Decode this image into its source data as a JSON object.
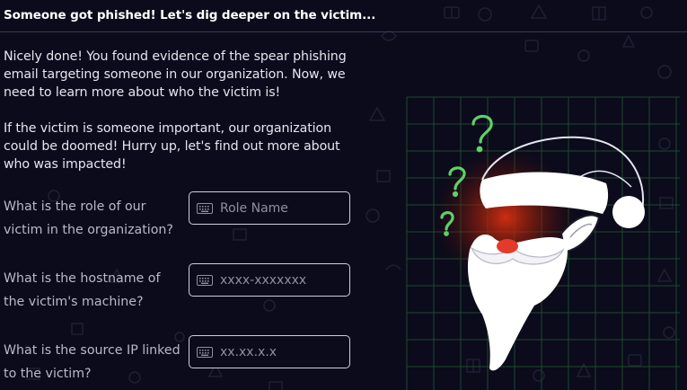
{
  "header": {
    "title": "Someone got phished! Let's dig deeper on the victim..."
  },
  "intro": {
    "paragraph1": "Nicely done! You found evidence of the spear phishing email targeting someone in our organization. Now, we need to learn more about who the victim is!",
    "paragraph2": "If the victim is someone important, our organization could be doomed! Hurry up, let's find out more about who was impacted!"
  },
  "questions": [
    {
      "label": "What is the role of our victim in the organization?",
      "placeholder": "Role Name",
      "value": ""
    },
    {
      "label": "What is the hostname of the victim's machine?",
      "placeholder": "xxxx-xxxxxxx",
      "value": ""
    },
    {
      "label": "What is the source IP linked to the victim?",
      "placeholder": "xx.xx.x.x",
      "value": ""
    }
  ],
  "icons": {
    "input_icon": "keyboard-icon",
    "illustration": "santa-question-marks"
  },
  "colors": {
    "background": "#0b0b1c",
    "accent_green": "#5fd068",
    "glow_red": "#c0260d"
  }
}
